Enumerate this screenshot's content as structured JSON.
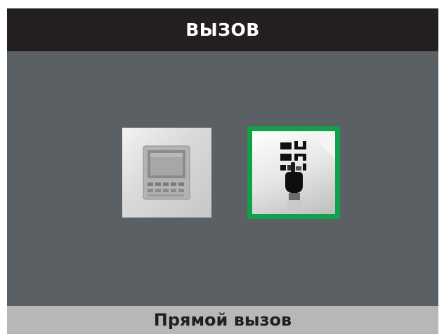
{
  "header": {
    "title": "ВЫЗОВ"
  },
  "icons": [
    {
      "name": "monitor-device-icon",
      "selected": false
    },
    {
      "name": "keypad-direct-call-icon",
      "selected": true
    }
  ],
  "footer": {
    "selected_label": "Прямой вызов"
  },
  "colors": {
    "title_bar": "#231f20",
    "background": "#5b6064",
    "status_bar": "#b7b7b7",
    "selection_border": "#13a04a"
  }
}
